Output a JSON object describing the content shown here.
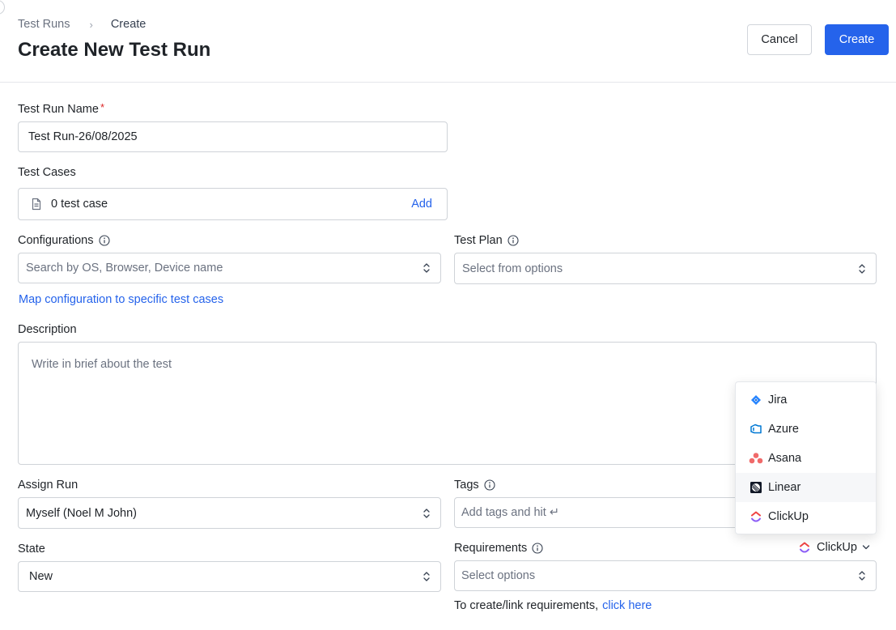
{
  "header": {
    "breadcrumb": {
      "parent": "Test Runs",
      "separator": "›",
      "current": "Create"
    },
    "title": "Create New Test Run",
    "cancel_label": "Cancel",
    "create_label": "Create"
  },
  "form": {
    "run_name": {
      "label": "Test Run Name",
      "required_mark": "*",
      "value": "Test Run-26/08/2025"
    },
    "test_cases": {
      "label": "Test Cases",
      "value": "0 test case",
      "add_label": "Add"
    },
    "configurations": {
      "label": "Configurations",
      "placeholder": "Search by OS, Browser, Device name",
      "map_link": "Map configuration to specific test cases"
    },
    "test_plan": {
      "label": "Test Plan",
      "placeholder": "Select from options"
    },
    "description": {
      "label": "Description",
      "placeholder": "Write in brief about the test"
    },
    "assign_run": {
      "label": "Assign Run",
      "value": "Myself (Noel M John)"
    },
    "tags": {
      "label": "Tags",
      "placeholder": "Add tags and hit ↵"
    },
    "state": {
      "label": "State",
      "value": "New"
    },
    "requirements": {
      "label": "Requirements",
      "provider": "ClickUp",
      "placeholder": "Select options",
      "hint_text": "To create/link requirements,",
      "hint_link": "click here"
    }
  },
  "provider_menu": {
    "items": [
      {
        "label": "Jira",
        "icon": "jira-icon"
      },
      {
        "label": "Azure",
        "icon": "azure-icon"
      },
      {
        "label": "Asana",
        "icon": "asana-icon"
      },
      {
        "label": "Linear",
        "icon": "linear-icon"
      },
      {
        "label": "ClickUp",
        "icon": "clickup-icon"
      }
    ],
    "hovered": "Linear"
  },
  "colors": {
    "primary": "#2563eb",
    "required": "#dc2626",
    "border": "#cfd3d8"
  }
}
